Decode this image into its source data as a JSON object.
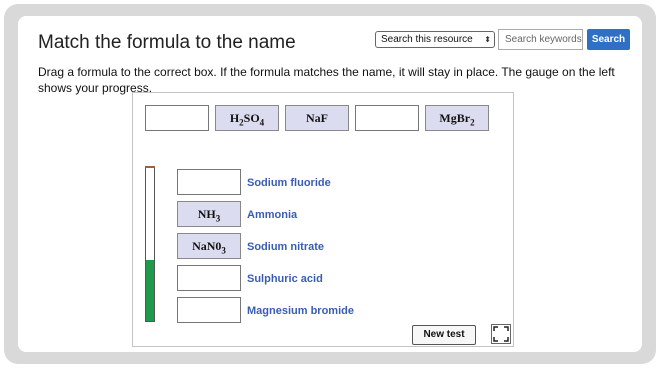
{
  "header": {
    "title": "Match the formula to the name",
    "search_select": "Search this resource",
    "search_placeholder": "Search keywords.",
    "search_button": "Search"
  },
  "instructions": "Drag a formula to the correct box. If the formula matches the name, it will stay in place. The gauge on the left shows your progress.",
  "palette": {
    "tiles": [
      {
        "base": "H",
        "sub1": "2",
        "mid": "SO",
        "sub2": "4"
      },
      {
        "base": "NaF"
      },
      {
        "base": "MgBr",
        "sub1": "2"
      }
    ]
  },
  "targets": [
    {
      "name": "Sodium fluoride",
      "filled": ""
    },
    {
      "name": "Ammonia",
      "filled_base": "NH",
      "filled_sub": "3"
    },
    {
      "name": "Sodium nitrate",
      "filled_base": "NaN0",
      "filled_sub": "3"
    },
    {
      "name": "Sulphuric acid",
      "filled": ""
    },
    {
      "name": "Magnesium bromide",
      "filled": ""
    }
  ],
  "progress": 0.4,
  "controls": {
    "new_test": "New test",
    "fullscreen_icon": "expand-icon"
  },
  "colors": {
    "accent": "#2f70c4",
    "tile_bg": "#dcdcf0",
    "target_text": "#3a5db0",
    "gauge_fill": "#1f9a4a"
  }
}
